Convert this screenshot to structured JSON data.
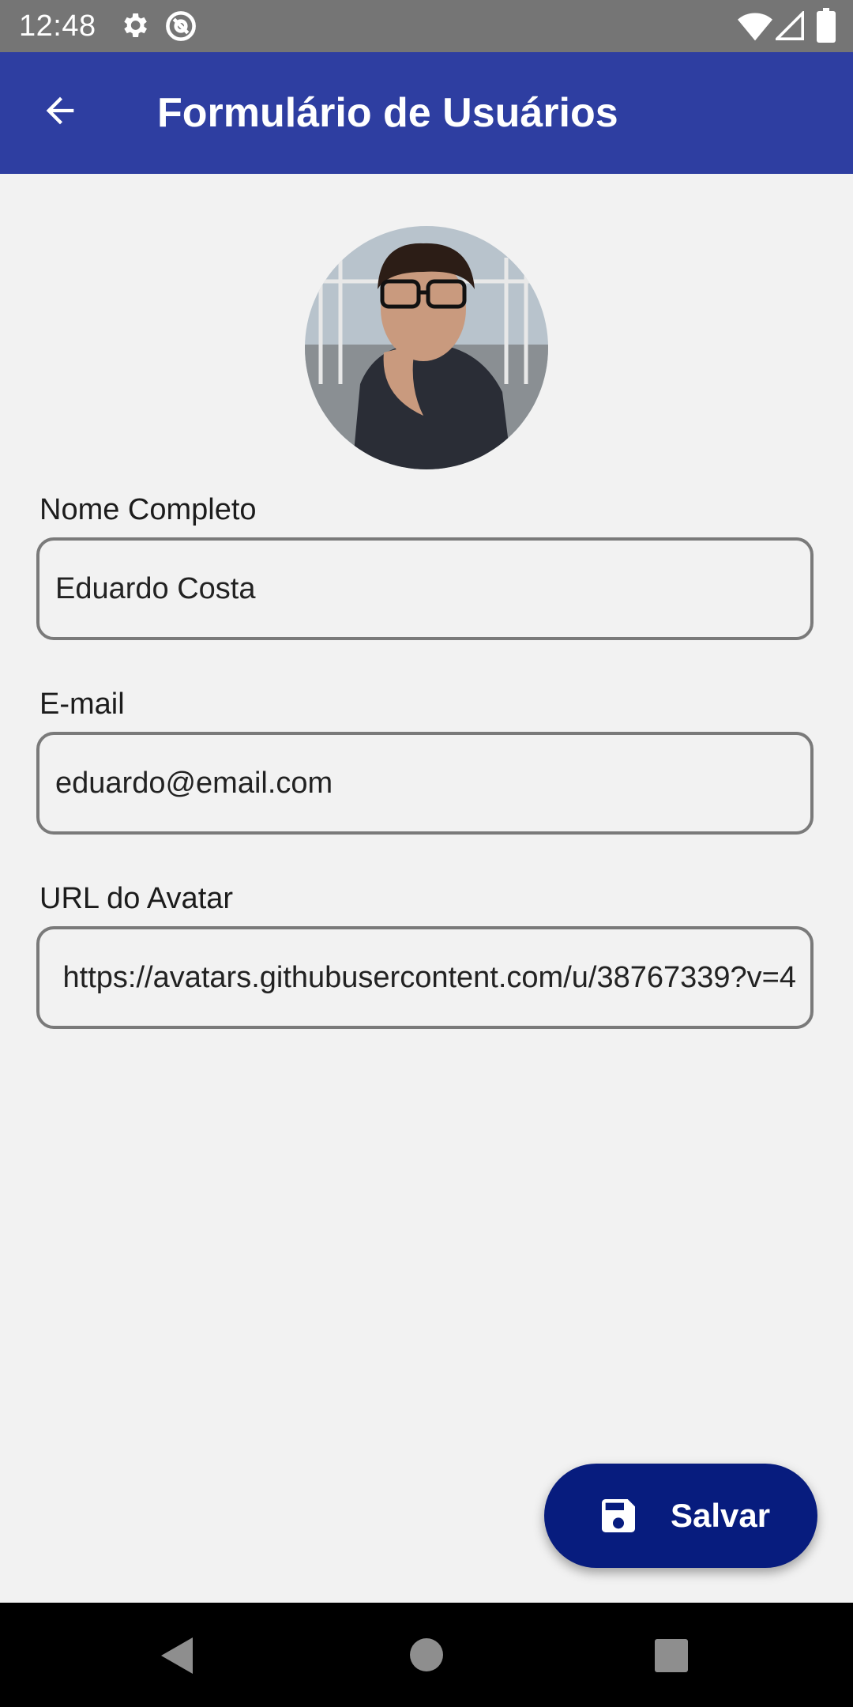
{
  "status_bar": {
    "time": "12:48",
    "icons": [
      "gear-icon",
      "at-sign-icon",
      "wifi-icon",
      "cellular-signal-icon",
      "battery-icon"
    ]
  },
  "app_bar": {
    "title": "Formulário de Usuários",
    "back_icon": "arrow-left-icon",
    "color": "#2e3ea1"
  },
  "form": {
    "name": {
      "label": "Nome Completo",
      "value": "Eduardo Costa"
    },
    "email": {
      "label": "E-mail",
      "value": "eduardo@email.com"
    },
    "avatar_url": {
      "label": "URL do Avatar",
      "value": "https://avatars.githubusercontent.com/u/38767339?v=4"
    }
  },
  "fab": {
    "label": "Salvar",
    "icon": "save-icon",
    "color": "#071c7e"
  },
  "nav_bar": {
    "buttons": [
      "back-triangle-icon",
      "home-circle-icon",
      "recents-square-icon"
    ]
  }
}
